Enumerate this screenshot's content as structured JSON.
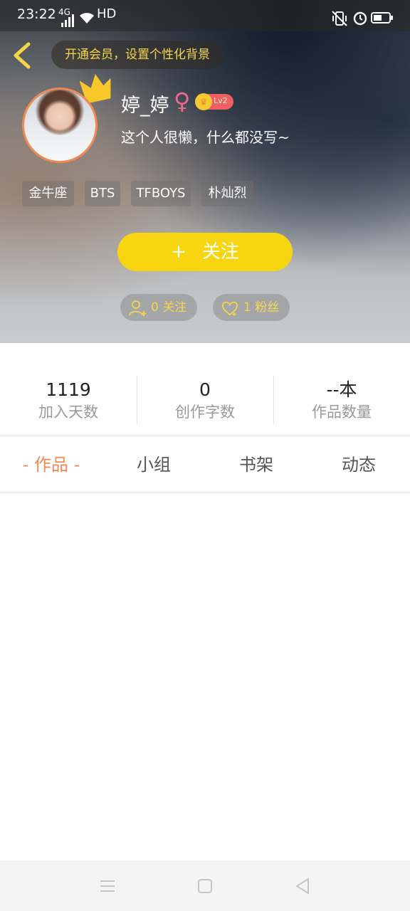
{
  "status": {
    "time": "23:22",
    "network": "4G",
    "hd": "HD",
    "icons": [
      "signal-icon",
      "wifi-icon",
      "vibrate-icon",
      "alarm-icon",
      "battery-icon"
    ]
  },
  "header": {
    "back_icon": "chevron-left-icon",
    "vip_banner": "开通会员，设置个性化背景",
    "nickname": "婷_婷",
    "gender_symbol": "♀",
    "level": "Lv2",
    "bio": "这个人很懒，什么都没写~",
    "tags": [
      "金牛座",
      "BTS",
      "TFBOYS",
      "朴灿烈"
    ],
    "follow_button": {
      "plus": "+",
      "label": "关注"
    },
    "following_label": "0 关注",
    "followers_label": "1 粉丝"
  },
  "stats": [
    {
      "value": "1119",
      "label": "加入天数"
    },
    {
      "value": "0",
      "label": "创作字数"
    },
    {
      "value": "--本",
      "label": "作品数量"
    }
  ],
  "tabs": [
    "- 作品 -",
    "小组",
    "书架",
    "动态"
  ],
  "active_tab": 0,
  "colors": {
    "accent": "#f08a55",
    "follow_button": "#f8d511",
    "highlight_text": "#f5d64a",
    "gender": "#e96a93",
    "level_badge": "#ef5f66"
  },
  "navbar_icons": [
    "menu-icon",
    "home-icon",
    "back-icon"
  ]
}
